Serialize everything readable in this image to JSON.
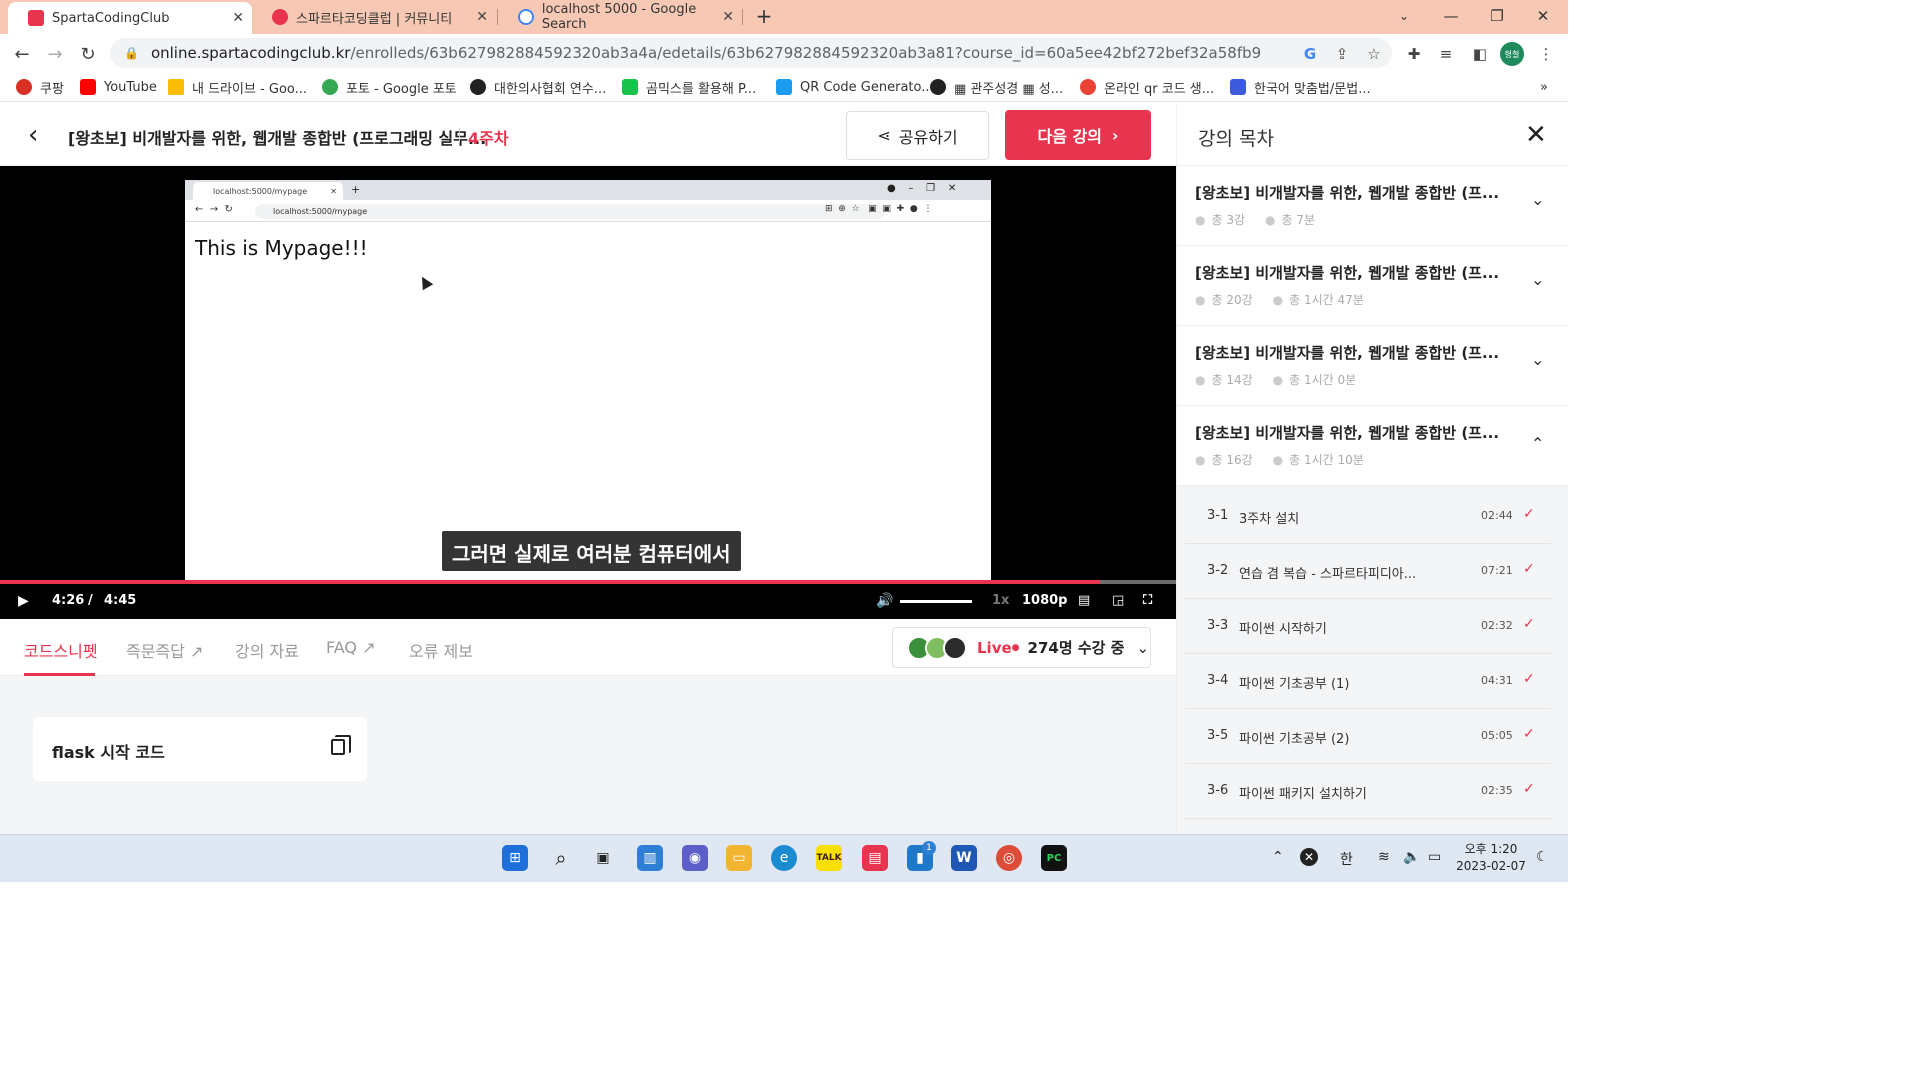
{
  "browser": {
    "tabs": [
      {
        "title": "SpartaCodingClub",
        "active": true
      },
      {
        "title": "스파르타코딩클럽 | 커뮤니티",
        "active": false
      },
      {
        "title": "localhost 5000 - Google Search",
        "active": false
      }
    ],
    "url_domain": "online.spartacodingclub.kr",
    "url_path": "/enrolleds/63b627982884592320ab3a4a/edetails/63b627982884592320ab3a81?course_id=60a5ee42bf272bef32a58fb9",
    "profile_label": "형철",
    "bookmarks": [
      "쿠팡",
      "YouTube",
      "내 드라이브 - Goo...",
      "포토 - Google 포토",
      "대한의사협회 연수...",
      "곰믹스를 활용해 P...",
      "QR Code Generato...",
      "▦ 관주성경 ▦ 성...",
      "온라인 qr 코드 생...",
      "한국어 맞춤법/문법..."
    ],
    "bookmarks_more": "»"
  },
  "header": {
    "course_title": "[왕초보] 비개발자를 위한, 웹개발 종합반 (프로그래밍 실무...",
    "week": "4주차",
    "share_label": "공유하기",
    "next_label": "다음 강의"
  },
  "video": {
    "inner_tab_title": "localhost:5000/mypage",
    "inner_url": "localhost:5000/mypage",
    "inner_content": "This is Mypage!!!",
    "caption": "그러면 실제로 여러분 컴퓨터에서",
    "current_time": "4:26",
    "time_separator": "/",
    "duration": "4:45",
    "progress_fraction": 0.935,
    "volume_fraction": 1.0,
    "speed": "1x",
    "quality": "1080p"
  },
  "lecture_tabs": [
    {
      "label": "코드스니펫",
      "active": true
    },
    {
      "label": "즉문즉답 ↗",
      "active": false
    },
    {
      "label": "강의 자료",
      "active": false
    },
    {
      "label": "FAQ ↗",
      "active": false
    },
    {
      "label": "오류 제보",
      "active": false
    }
  ],
  "live": {
    "label": "Live",
    "count": "274명 수강 중"
  },
  "snippet": {
    "title": "flask 시작 코드"
  },
  "sidebar": {
    "title": "강의 목차",
    "weeks": [
      {
        "title": "[왕초보] 비개발자를 위한, 웹개발 종합반 (프...",
        "lessons": "총 3강",
        "time": "총 7분",
        "expanded": false
      },
      {
        "title": "[왕초보] 비개발자를 위한, 웹개발 종합반 (프...",
        "lessons": "총 20강",
        "time": "총 1시간 47분",
        "expanded": false
      },
      {
        "title": "[왕초보] 비개발자를 위한, 웹개발 종합반 (프...",
        "lessons": "총 14강",
        "time": "총 1시간 0분",
        "expanded": false
      },
      {
        "title": "[왕초보] 비개발자를 위한, 웹개발 종합반 (프...",
        "lessons": "총 16강",
        "time": "총 1시간 10분",
        "expanded": true
      }
    ],
    "lessons": [
      {
        "num": "3-1",
        "name": "3주차 설치",
        "duration": "02:44"
      },
      {
        "num": "3-2",
        "name": "연습 겸 복습 - 스파르타피디아...",
        "duration": "07:21"
      },
      {
        "num": "3-3",
        "name": "파이썬 시작하기",
        "duration": "02:32"
      },
      {
        "num": "3-4",
        "name": "파이썬 기초공부 (1)",
        "duration": "04:31"
      },
      {
        "num": "3-5",
        "name": "파이썬 기초공부 (2)",
        "duration": "05:05"
      },
      {
        "num": "3-6",
        "name": "파이썬 패키지 설치하기",
        "duration": "02:35"
      }
    ]
  },
  "taskbar": {
    "ime": "한",
    "time": "오후 1:20",
    "date": "2023-02-07",
    "badge": "1"
  }
}
